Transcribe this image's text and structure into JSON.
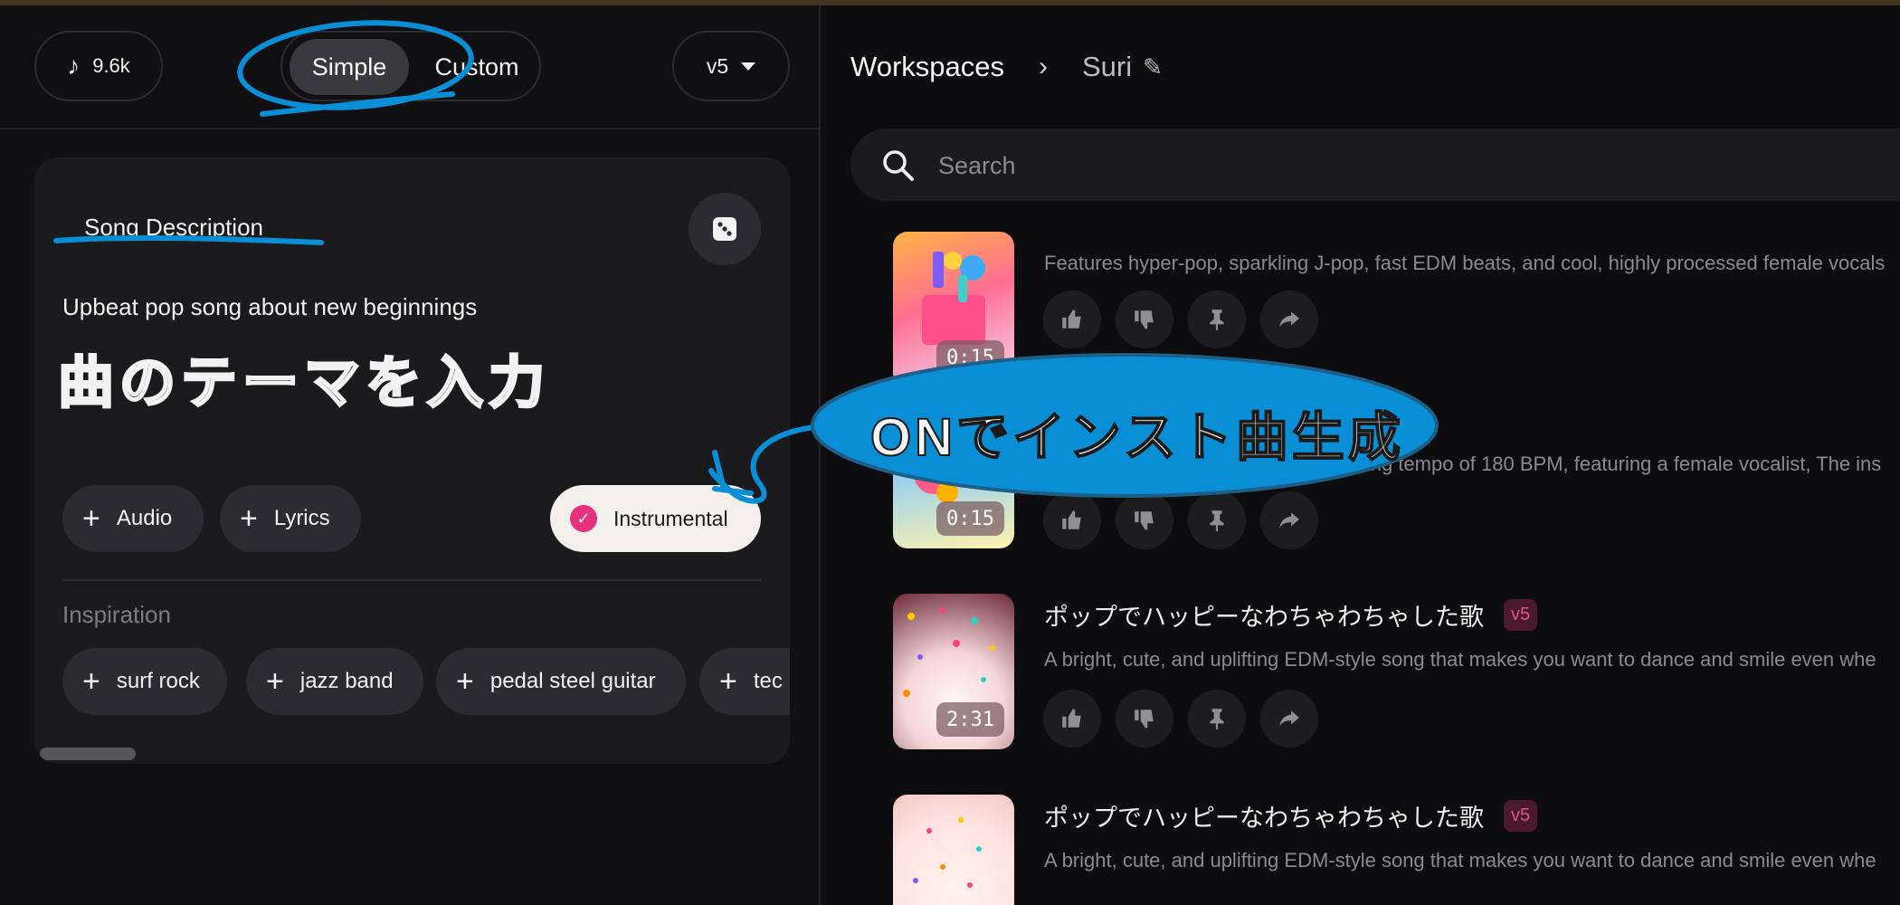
{
  "header": {
    "credits_count": "9.6k",
    "mode_options": [
      "Simple",
      "Custom"
    ],
    "active_mode": "Simple",
    "version": "v5"
  },
  "song_card": {
    "tab_label": "Song Description",
    "description_value": "Upbeat pop song about new beginnings",
    "annotation_text": "曲のテーマを入力",
    "chips": [
      "Audio",
      "Lyrics"
    ],
    "instrumental_label": "Instrumental",
    "instrumental_checked": true,
    "inspiration_label": "Inspiration",
    "inspiration_chips": [
      "surf rock",
      "jazz band",
      "pedal steel guitar",
      "tec"
    ]
  },
  "workspace": {
    "breadcrumb_root": "Workspaces",
    "breadcrumb_current": "Suri",
    "search_placeholder": "Search"
  },
  "songs": [
    {
      "title": "",
      "description": "Features hyper-pop, sparkling J-pop, fast EDM beats, and cool, highly processed female vocals",
      "duration": "0:15"
    },
    {
      "title": "",
      "description": "A high-energy J-pop track with a driving tempo of 180 BPM, featuring a female vocalist, The ins",
      "duration": "0:15"
    },
    {
      "title": "ポップでハッピーなわちゃわちゃした歌",
      "badge": "v5",
      "description": "A bright, cute, and uplifting EDM-style song that makes you want to dance and smile even whe",
      "duration": "2:31"
    },
    {
      "title": "ポップでハッピーなわちゃわちゃした歌",
      "badge": "v5",
      "description": "A bright, cute, and uplifting EDM-style song that makes you want to dance and smile even whe",
      "duration": ""
    }
  ],
  "overlay": {
    "callout_text": "ONでインスト曲生成",
    "annotation_color": "#0a8fd6"
  }
}
